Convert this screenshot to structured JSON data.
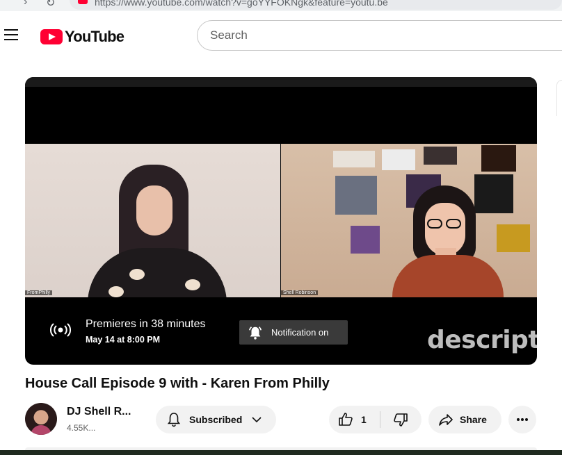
{
  "browser": {
    "url": "https://www.youtube.com/watch?v=goYYFOKNgk&feature=youtu.be"
  },
  "header": {
    "logo_text": "YouTube",
    "search_placeholder": "Search"
  },
  "player": {
    "left_participant": "FromPhilly",
    "right_participant": "Shell Robinson",
    "premiere_title": "Premieres in 38 minutes",
    "premiere_date": "May 14 at 8:00 PM",
    "notification_label": "Notification on",
    "watermark": "descript"
  },
  "video": {
    "title": "House Call Episode 9 with - Karen From Philly",
    "channel_name": "DJ Shell R...",
    "subscribers": "4.55K...",
    "subscribe_label": "Subscribed",
    "like_count": "1",
    "share_label": "Share"
  },
  "colors": {
    "brand": "#ff0033",
    "text": "#0f0f0f",
    "secondary_text": "#606060",
    "button_bg": "#f2f2f2"
  }
}
